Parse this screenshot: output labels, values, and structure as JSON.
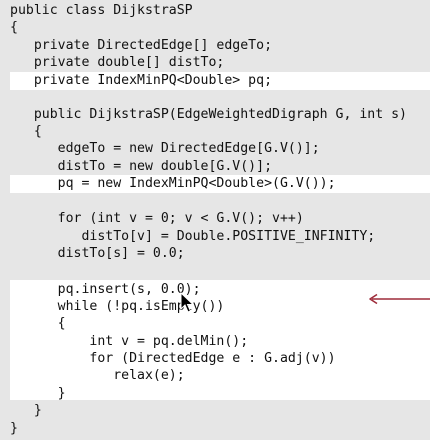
{
  "colors": {
    "background": "#e6e6e6",
    "highlight": "#ffffff",
    "text": "#111111",
    "arrow": "#9e2b3a"
  },
  "icons": {
    "pointer_arrow": "arrow-left-icon",
    "cursor": "mouse-pointer-icon"
  },
  "code": {
    "lines": [
      "public class DijkstraSP",
      "{",
      "   private DirectedEdge[] edgeTo;",
      "   private double[] distTo;",
      "   private IndexMinPQ<Double> pq;",
      "",
      "   public DijkstraSP(EdgeWeightedDigraph G, int s)",
      "   {",
      "      edgeTo = new DirectedEdge[G.V()];",
      "      distTo = new double[G.V()];",
      "      pq = new IndexMinPQ<Double>(G.V());",
      "",
      "      for (int v = 0; v < G.V(); v++)",
      "         distTo[v] = Double.POSITIVE_INFINITY;",
      "      distTo[s] = 0.0;",
      "",
      "      pq.insert(s, 0.0);",
      "      while (!pq.isEmpty())",
      "      {",
      "          int v = pq.delMin();",
      "          for (DirectedEdge e : G.adj(v))",
      "             relax(e);",
      "      }",
      "   }",
      "}"
    ]
  }
}
